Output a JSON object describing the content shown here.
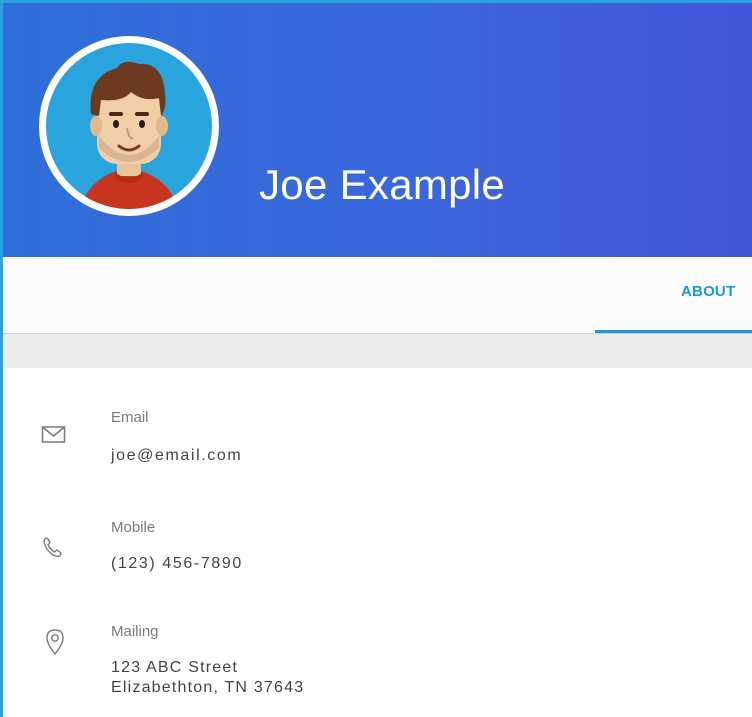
{
  "profile": {
    "name": "Joe Example"
  },
  "tabs": {
    "about": "ABOUT"
  },
  "contact": {
    "email": {
      "label": "Email",
      "value": "joe@email.com",
      "icon": "mail-icon"
    },
    "mobile": {
      "label": "Mobile",
      "value": "(123) 456-7890",
      "icon": "phone-icon"
    },
    "mailing": {
      "label": "Mailing",
      "line1": "123 ABC Street",
      "line2": "Elizabethton, TN 37643",
      "icon": "location-pin-icon"
    }
  },
  "colors": {
    "header_start": "#2e6fd8",
    "header_end": "#4256d8",
    "accent": "#1c9ad6"
  }
}
